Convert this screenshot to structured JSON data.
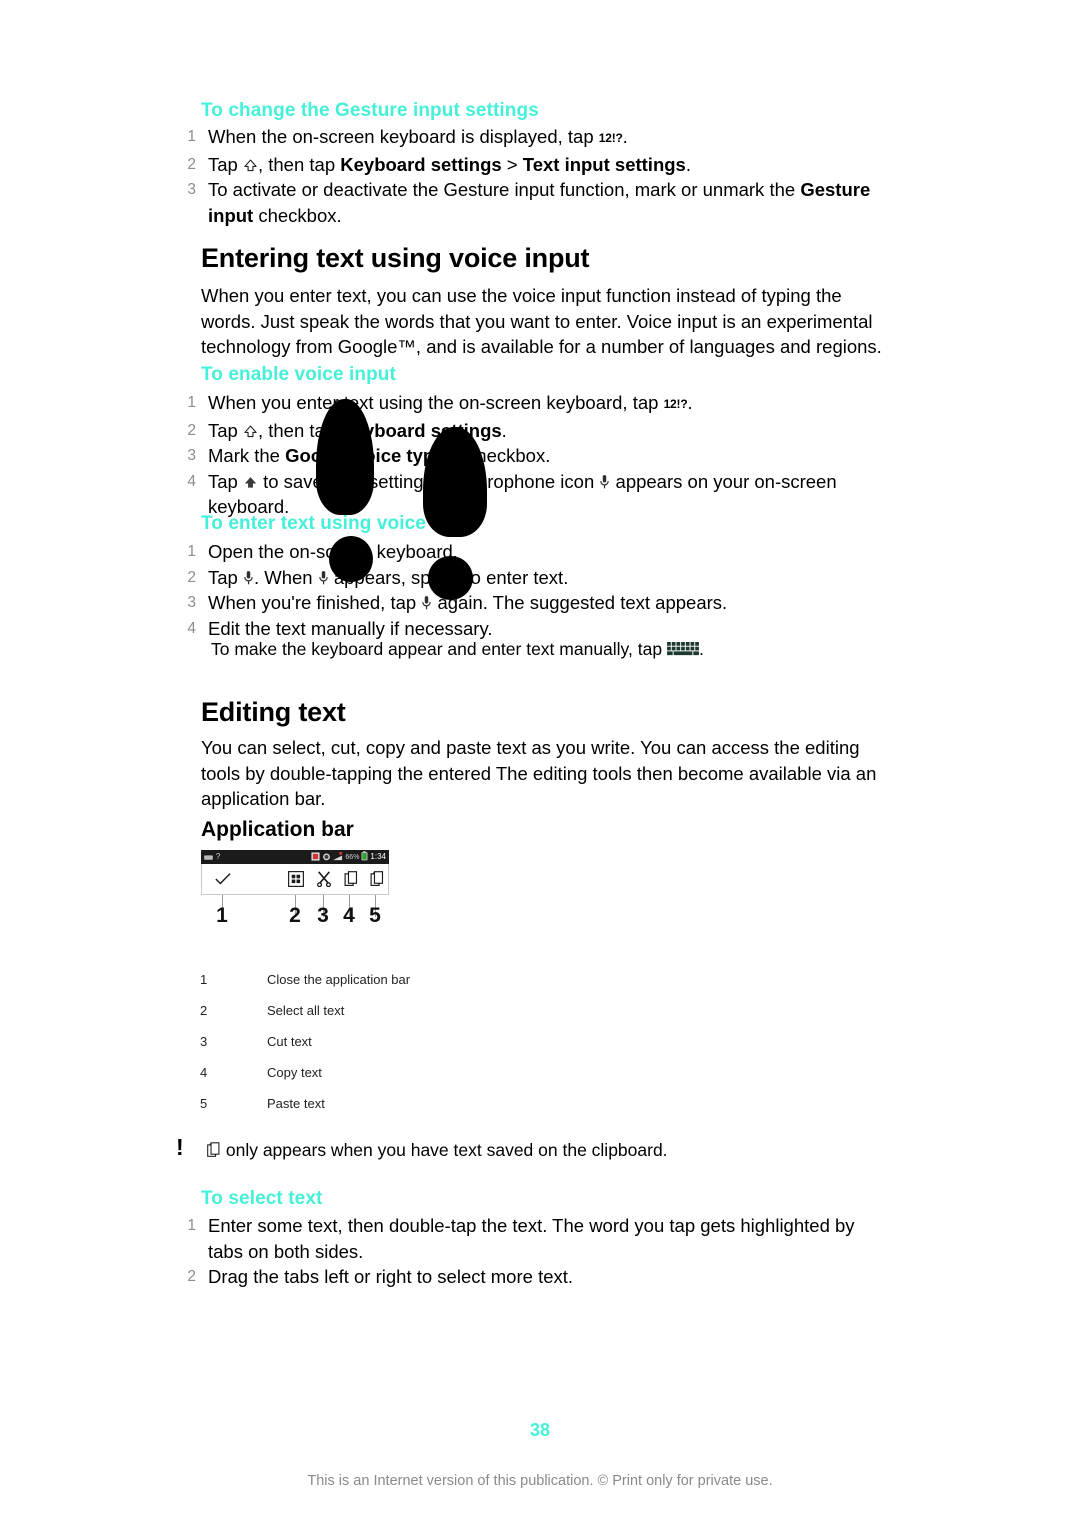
{
  "colors": {
    "accent_cyan": "#46F0D8",
    "body_text": "#000000",
    "muted_grey": "#8a8a8a"
  },
  "sections": {
    "gesture_settings": {
      "heading": "To change the Gesture input settings",
      "steps": [
        {
          "num": "1",
          "pre": "When the on-screen keyboard is displayed, tap ",
          "key": "12!?",
          "post": "."
        },
        {
          "num": "2",
          "a": "Tap ",
          "b": ", then tap ",
          "bold1": "Keyboard settings",
          "c": " > ",
          "bold2": "Text input settings",
          "d": "."
        },
        {
          "num": "3",
          "a": "To activate or deactivate the Gesture input function, mark or unmark the ",
          "bold1": "Gesture input",
          "b": " checkbox."
        }
      ]
    },
    "voice_input": {
      "title": "Entering text using voice input",
      "paragraph": "When you enter text, you can use the voice input function instead of typing the words. Just speak the words that you want to enter. Voice input is an experimental technology from Google™, and is available for a number of languages and regions."
    },
    "enable_voice": {
      "heading": "To enable voice input",
      "steps": [
        {
          "num": "1",
          "pre": "When you enter text using the on-screen keyboard, tap ",
          "key": "12!?",
          "post": "."
        },
        {
          "num": "2",
          "a": "Tap ",
          "b": ", then tap ",
          "bold1": "Keyboard settings",
          "c": "."
        },
        {
          "num": "3",
          "a": "Mark the ",
          "bold1": "Google voice typing",
          "b": " checkbox."
        },
        {
          "num": "4",
          "a": "Tap ",
          "b": " to save your settings. A microphone icon ",
          "c": " appears on your on-screen keyboard."
        }
      ]
    },
    "enter_voice": {
      "heading": "To enter text using voice input",
      "steps": [
        {
          "num": "1",
          "a": "Open the on-screen keyboard."
        },
        {
          "num": "2",
          "a": "Tap ",
          "b": ". When ",
          "c": " appears, speak to enter text."
        },
        {
          "num": "3",
          "a": "When you're finished, tap ",
          "b": " again. The suggested text appears."
        },
        {
          "num": "4",
          "a": "Edit the text manually if necessary."
        }
      ],
      "tip": {
        "pre": "To make the keyboard appear and enter text manually, tap ",
        "post": "."
      }
    },
    "editing_text": {
      "title": "Editing text",
      "paragraph": "You can select, cut, copy and paste text as you write. You can access the editing tools by double-tapping the entered The editing tools then become available via an application bar."
    },
    "application_bar": {
      "title": "Application bar",
      "figure": {
        "status_bar": {
          "battery_percent": "66%",
          "time": "1:34"
        },
        "toolbar_icons": [
          {
            "id": "1",
            "icon": "checkmark-icon"
          },
          {
            "id": "2",
            "icon": "select-all-icon"
          },
          {
            "id": "3",
            "icon": "scissors-cut-icon"
          },
          {
            "id": "4",
            "icon": "copy-icon"
          },
          {
            "id": "5",
            "icon": "paste-icon"
          }
        ],
        "callout_numbers": [
          "1",
          "2",
          "3",
          "4",
          "5"
        ]
      },
      "legend": [
        {
          "num": "1",
          "label": "Close the application bar"
        },
        {
          "num": "2",
          "label": "Select all text"
        },
        {
          "num": "3",
          "label": "Cut text"
        },
        {
          "num": "4",
          "label": "Copy text"
        },
        {
          "num": "5",
          "label": "Paste text"
        }
      ]
    },
    "clipboard_note": {
      "marker": "!",
      "text": " only appears when you have text saved on the clipboard."
    },
    "select_text": {
      "heading": "To select text",
      "steps": [
        {
          "num": "1",
          "a": "Enter some text, then double-tap the text. The word you tap gets highlighted by tabs on both sides."
        },
        {
          "num": "2",
          "a": "Drag the tabs left or right to select more text."
        }
      ]
    }
  },
  "footer": {
    "page_number": "38",
    "notice": "This is an Internet version of this publication. © Print only for private use."
  }
}
